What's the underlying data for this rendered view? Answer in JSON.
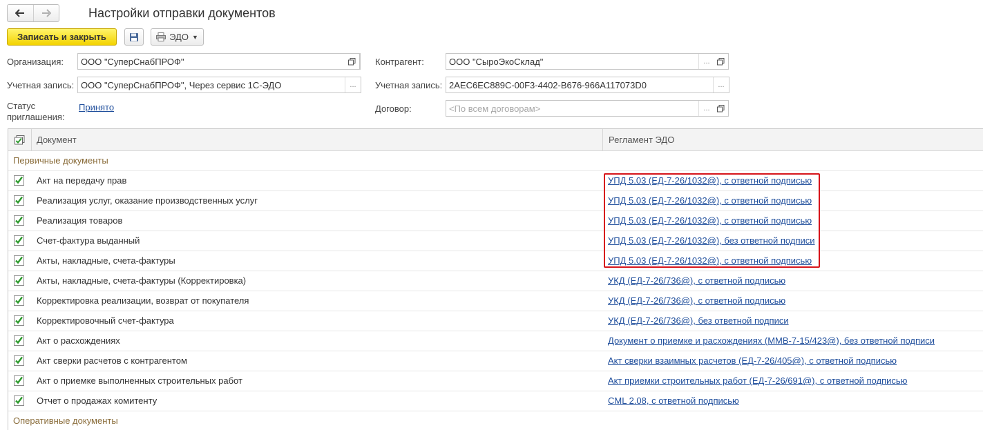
{
  "nav": {
    "back_icon": "arrow-left-icon",
    "forward_icon": "arrow-right-icon"
  },
  "window": {
    "title": "Настройки отправки документов"
  },
  "toolbar": {
    "save_close_label": "Записать и закрыть",
    "save_icon": "floppy-disk-icon",
    "edo_label": "ЭДО",
    "edo_icon": "printer-icon"
  },
  "form": {
    "organization": {
      "label": "Организация:",
      "value": "ООО \"СуперСнабПРОФ\""
    },
    "account_left": {
      "label": "Учетная запись:",
      "value": "ООО \"СуперСнабПРОФ\", Через сервис 1С-ЭДО"
    },
    "invite_status": {
      "label": "Статус приглашения:",
      "value": "Принято"
    },
    "counterparty": {
      "label": "Контрагент:",
      "value": "ООО \"СыроЭкоСклад\""
    },
    "account_right": {
      "label": "Учетная запись:",
      "value": "2AEC6EC889C-00F3-4402-B676-966A117073D0"
    },
    "contract": {
      "label": "Договор:",
      "placeholder": "<По всем договорам>"
    }
  },
  "table": {
    "columns": {
      "document": "Документ",
      "regulation": "Регламент ЭДО"
    },
    "groups": [
      {
        "title": "Первичные документы",
        "rows": [
          {
            "document": "Акт на передачу прав",
            "regulation": "УПД 5.03 (ЕД-7-26/1032@), с ответной подписью",
            "checked": true
          },
          {
            "document": "Реализация услуг, оказание производственных услуг",
            "regulation": "УПД 5.03 (ЕД-7-26/1032@), с ответной подписью",
            "checked": true
          },
          {
            "document": "Реализация товаров",
            "regulation": "УПД 5.03 (ЕД-7-26/1032@), с ответной подписью",
            "checked": true
          },
          {
            "document": "Счет-фактура выданный",
            "regulation": "УПД 5.03 (ЕД-7-26/1032@), без ответной подписи",
            "checked": true
          },
          {
            "document": "Акты, накладные, счета-фактуры",
            "regulation": "УПД 5.03 (ЕД-7-26/1032@), с ответной подписью",
            "checked": true
          },
          {
            "document": "Акты, накладные, счета-фактуры (Корректировка)",
            "regulation": "УКД (ЕД-7-26/736@), с ответной подписью",
            "checked": true
          },
          {
            "document": "Корректировка реализации, возврат от покупателя",
            "regulation": "УКД (ЕД-7-26/736@), с ответной подписью",
            "checked": true
          },
          {
            "document": "Корректировочный счет-фактура",
            "regulation": "УКД (ЕД-7-26/736@), без ответной подписи",
            "checked": true
          },
          {
            "document": "Акт о расхождениях",
            "regulation": "Документ о приемке и расхождениях (ММВ-7-15/423@), без ответной подписи",
            "checked": true
          },
          {
            "document": "Акт сверки расчетов с контрагентом",
            "regulation": "Акт сверки взаимных расчетов (ЕД-7-26/405@), с ответной подписью",
            "checked": true
          },
          {
            "document": "Акт о приемке выполненных строительных работ",
            "regulation": "Акт приемки строительных работ (ЕД-7-26/691@), с ответной подписью",
            "checked": true
          },
          {
            "document": "Отчет о продажах комитенту",
            "regulation": "CML 2.08, с ответной подписью",
            "checked": true
          }
        ]
      },
      {
        "title": "Оперативные документы",
        "rows": []
      }
    ]
  },
  "colors": {
    "accent_yellow": "#f3d300",
    "link_blue": "#1f4e9c",
    "highlight_red": "#d7141a",
    "check_green": "#2e9b2e"
  }
}
